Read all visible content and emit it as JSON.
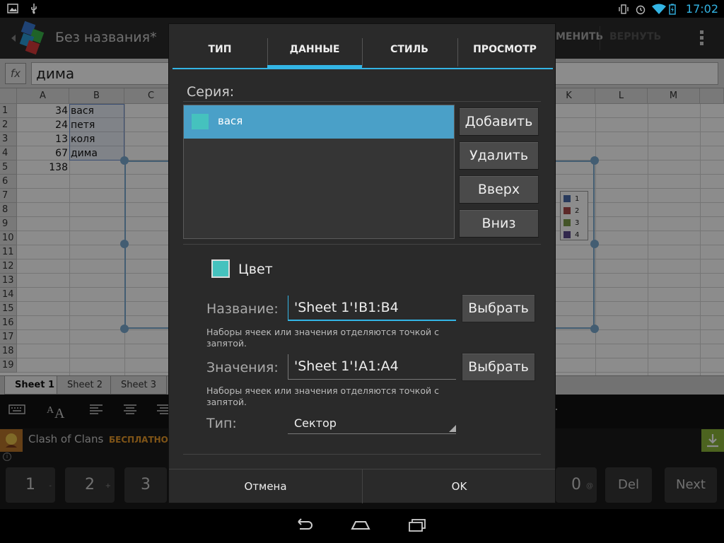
{
  "status_bar": {
    "time": "17:02"
  },
  "action_bar": {
    "title": "Без названия*",
    "apply_label": "МЕНИТЬ",
    "redo_label": "ВЕРНУТЬ"
  },
  "formula_bar": {
    "fx_label": "fx",
    "value": "дима"
  },
  "sheet": {
    "columns": [
      "A",
      "B",
      "C",
      "K",
      "L",
      "M"
    ],
    "rows": [
      "1",
      "2",
      "3",
      "4",
      "5",
      "6",
      "7",
      "8",
      "9",
      "10",
      "11",
      "12",
      "13",
      "14",
      "15",
      "16",
      "17",
      "18",
      "19"
    ],
    "col_a": [
      "34",
      "24",
      "13",
      "67",
      "138"
    ],
    "col_b": [
      "вася",
      "петя",
      "коля",
      "дима"
    ],
    "legend": [
      "1",
      "2",
      "3",
      "4"
    ],
    "legend_colors": [
      "#4a6aa8",
      "#a84a4a",
      "#7a9a4a",
      "#5a4a8a"
    ]
  },
  "sheet_tabs": [
    "Sheet 1",
    "Sheet 2",
    "Sheet 3"
  ],
  "ad": {
    "title": "Clash of Clans",
    "badge": "БЕСПЛАТНО"
  },
  "keypad": {
    "keys": [
      "1",
      "2",
      "3",
      "0",
      "Del",
      "Next"
    ],
    "subs": [
      "-",
      "+",
      "",
      "@",
      "",
      ""
    ]
  },
  "dialog": {
    "tabs": [
      "ТИП",
      "ДАННЫЕ",
      "СТИЛЬ",
      "ПРОСМОТР"
    ],
    "active_tab": "ДАННЫЕ",
    "series_label": "Серия:",
    "series_items": [
      {
        "name": "вася",
        "color": "#45c2be"
      }
    ],
    "buttons": {
      "add": "Добавить",
      "delete": "Удалить",
      "up": "Вверх",
      "down": "Вниз"
    },
    "color_label": "Цвет",
    "name_label": "Название:",
    "name_value": "'Sheet 1'!B1:B4",
    "values_label": "Значения:",
    "values_value": "'Sheet 1'!A1:A4",
    "pick_label": "Выбрать",
    "hint": "Наборы ячеек или значения отделяются точкой с запятой.",
    "type_label": "Тип:",
    "type_value": "Сектор",
    "cancel": "Отмена",
    "ok": "OK"
  }
}
